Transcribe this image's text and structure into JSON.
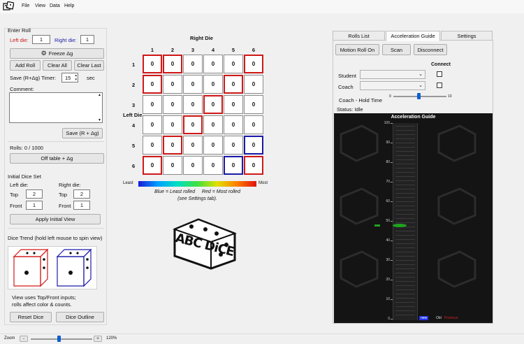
{
  "menu": [
    "File",
    "View",
    "Data",
    "Help"
  ],
  "left": {
    "enter_roll": "Enter Roll",
    "left_die_label": "Left die:",
    "left_die_value": "1",
    "right_die_label": "Right die:",
    "right_die_value": "1",
    "freeze": "Freeze Δg",
    "add_roll": "Add Roll",
    "clear_all": "Clear All",
    "clear_last": "Clear Last",
    "save_timer_label": "Save (R+Δg) Timer:",
    "save_timer_value": "15",
    "sec": "sec",
    "comment_label": "Comment:",
    "save_button": "Save (R + Δg)",
    "rolls": "Rolls: 0 / 1000",
    "off_table": "Off table + Δg",
    "initial_set": "Initial Dice Set",
    "init_left_label": "Left die:",
    "init_right_label": "Right die:",
    "top_label": "Top",
    "front_label": "Front",
    "left_top": "2",
    "left_front": "1",
    "right_top": "2",
    "right_front": "1",
    "apply_view": "Apply Initial View",
    "trend_title": "Dice Trend (hold left mouse to spin view)",
    "trend_note_1": "View uses Top/Front inputs;",
    "trend_note_2": "rolls affect color & counts.",
    "reset_dice": "Reset Dice",
    "dice_outline": "Dice Outline"
  },
  "grid": {
    "title": "Right Die",
    "left_die_label": "Left Die",
    "columns": [
      "1",
      "2",
      "3",
      "4",
      "5",
      "6"
    ],
    "rows": [
      "1",
      "2",
      "3",
      "4",
      "5",
      "6"
    ],
    "cells": [
      [
        "0",
        "0",
        "0",
        "0",
        "0",
        "0"
      ],
      [
        "0",
        "0",
        "0",
        "0",
        "0",
        "0"
      ],
      [
        "0",
        "0",
        "0",
        "0",
        "0",
        "0"
      ],
      [
        "0",
        "0",
        "0",
        "0",
        "0",
        "0"
      ],
      [
        "0",
        "0",
        "0",
        "0",
        "0",
        "0"
      ],
      [
        "0",
        "0",
        "0",
        "0",
        "0",
        "0"
      ]
    ],
    "highlight": [
      [
        "red",
        "red",
        "",
        "",
        "",
        "red"
      ],
      [
        "red",
        "",
        "",
        "",
        "red",
        ""
      ],
      [
        "",
        "",
        "",
        "red",
        "",
        ""
      ],
      [
        "",
        "",
        "red",
        "",
        "",
        ""
      ],
      [
        "",
        "red",
        "",
        "",
        "",
        "blue"
      ],
      [
        "red",
        "",
        "",
        "",
        "blue",
        "red"
      ]
    ],
    "legend_least": "Least",
    "legend_most": "Most",
    "caption_1": "Blue = Least rolled     Red = Most rolled",
    "caption_2": "(see Settings tab).",
    "logo_text": "ABC DiCE"
  },
  "right": {
    "tabs": [
      "Rolls List",
      "Acceleration Guide",
      "Settings"
    ],
    "active_tab": 1,
    "motion_roll": "Motion Roll On",
    "scan": "Scan",
    "disconnect": "Disconnect",
    "connect": "Connect",
    "student": "Student",
    "coach": "Coach",
    "coach_hold": "Coach - Hold Time",
    "hold_min": "0",
    "hold_max": "10",
    "hold_value": 0.48,
    "status": "Status: Idle",
    "guide_title": "Acceleration Guide",
    "guide_ticks": [
      "100",
      "90",
      "80",
      "70",
      "60",
      "50",
      "40",
      "30",
      "20",
      "10",
      "0"
    ],
    "guide_marker_value": 48,
    "legend_new": "new",
    "legend_old": "Old",
    "legend_previous": "Previous",
    "colors": {
      "marker": "#1fa31f",
      "new": "#2233ee",
      "previous": "#d02020"
    }
  },
  "zoom": {
    "label": "Zoom",
    "minus": "-",
    "plus": "+",
    "percent": "120%",
    "value": 0.45
  }
}
